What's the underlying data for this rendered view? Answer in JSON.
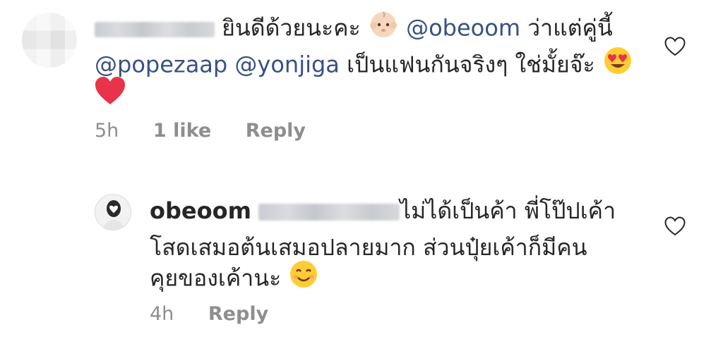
{
  "comments": [
    {
      "text_part1": "ยินดีด้วยนะคะ",
      "mention1": "@obeoom",
      "text_part2": "ว่าแต่คู่นี้",
      "mention2": "@popezaap",
      "mention3": "@yonjiga",
      "text_part3": "เป็นแฟนกันจริงๆ ใช่มั้ยจ๊ะ",
      "time": "5h",
      "likes": "1 like",
      "reply_label": "Reply"
    },
    {
      "username": "obeoom",
      "line1": "ไม่ได้เป็นค้า  พี่โป๊ปเค้า",
      "line2": "โสดเสมอต้นเสมอปลายมาก  ส่วนปุ๋ยเค้าก็มีคน",
      "line3": "คุยของเค้านะ",
      "time": "4h",
      "reply_label": "Reply"
    }
  ],
  "colors": {
    "text": "#262626",
    "mention": "#385185",
    "meta": "#8e8e8e",
    "heart_red": "#e0245e"
  }
}
